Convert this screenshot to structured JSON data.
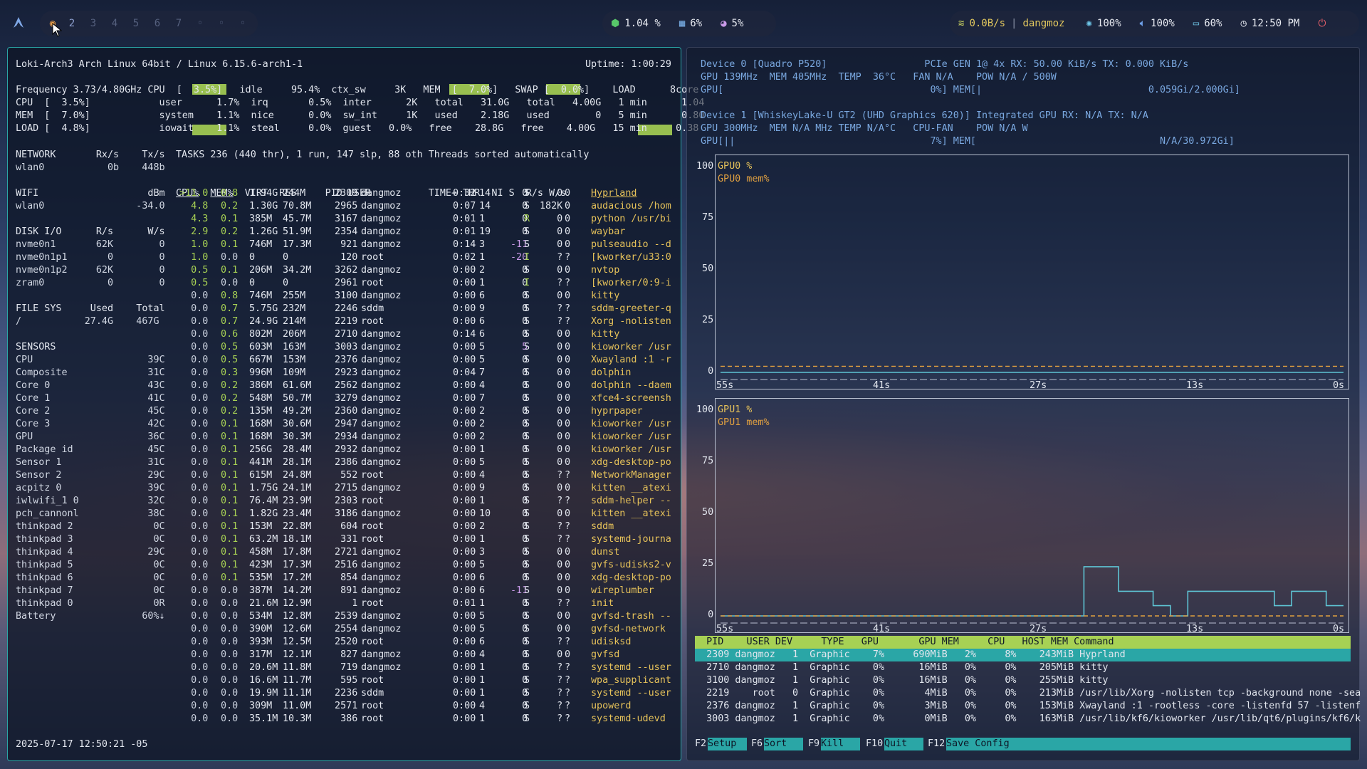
{
  "topbar": {
    "workspaces": [
      "2",
      "3",
      "4",
      "5",
      "6",
      "7",
      "◦",
      "◦",
      "◦"
    ],
    "cpu": "1.04 %",
    "ram": "6%",
    "disk": "5%",
    "network": "0.0B/s",
    "network_name": "dangmoz",
    "brightness": "100%",
    "volume": "100%",
    "battery": "60%",
    "clock": "12:50 PM"
  },
  "btop": {
    "host_line": "Loki-Arch3 Arch Linux 64bit / Linux 6.15.6-arch1-1",
    "uptime": "Uptime: 1:00:29",
    "summary": [
      "Frequency 3.73/4.80GHz CPU  [  3.5%]   idle     95.4%  ctx_sw     3K   MEM  [  7.0%]   SWAP [  0.0%]    LOAD      8core",
      "CPU  [  3.5%]            user      1.7%  irq       0.5%  inter      2K   total   31.0G   total   4.00G   1 min      1.04",
      "MEM  [  7.0%]            system    1.1%  nice      0.0%  sw_int     1K   used    2.18G   used        0   5 min      0.80",
      "LOAD [  4.8%]            iowait    1.1%  steal     0.0%  guest   0.0%   free    28.8G   free    4.00G   15 min     0.38"
    ],
    "tasks_line": "TASKS 236 (440 thr), 1 run, 147 slp, 88 oth Threads sorted automatically",
    "proc_header": "CPU%  MEM%  VIRT  RES     PID USER          TIME+ THR  NI S  R/s W/s  Command",
    "left_column": [
      "NETWORK       Rx/s    Tx/s",
      "wlan0           0b    448b",
      "",
      "WIFI                   dBm",
      "wlan0                -34.0",
      "",
      "DISK I/O      R/s      W/s",
      "nvme0n1       62K        0",
      "nvme0n1p1       0        0",
      "nvme0n1p2     62K        0",
      "zram0           0        0",
      "",
      "FILE SYS     Used    Total",
      "/           27.4G    467G",
      "",
      "SENSORS",
      "CPU                    39C",
      "Composite              31C",
      "Core 0                 43C",
      "Core 1                 41C",
      "Core 2                 45C",
      "Core 3                 42C",
      "GPU                    36C",
      "Package id             45C",
      "Sensor 1               31C",
      "Sensor 2               29C",
      "acpitz 0               39C",
      "iwlwifi_1 0            32C",
      "pch_cannonl            38C",
      "thinkpad 2              0C",
      "thinkpad 3              0C",
      "thinkpad 4             29C",
      "thinkpad 5              0C",
      "thinkpad 6              0C",
      "thinkpad 7              0C",
      "thinkpad 0              0R",
      "Battery               60%↓"
    ],
    "processes": [
      [
        ">11.0",
        "0.8",
        "1.94G",
        "244M",
        "2309",
        "dangmoz",
        "0:32",
        "14",
        "0",
        "S",
        "0",
        "0",
        "Hyprland"
      ],
      [
        "4.8",
        "0.2",
        "1.30G",
        "70.8M",
        "2965",
        "dangmoz",
        "0:07",
        "14",
        "0",
        "S",
        "182K",
        "0",
        "audacious /hom"
      ],
      [
        "4.3",
        "0.1",
        "385M",
        "45.7M",
        "3167",
        "dangmoz",
        "0:01",
        "1",
        "0",
        "R",
        "0",
        "0",
        "python /usr/bi"
      ],
      [
        "2.9",
        "0.2",
        "1.26G",
        "51.9M",
        "2354",
        "dangmoz",
        "0:01",
        "19",
        "0",
        "S",
        "0",
        "0",
        "waybar"
      ],
      [
        "1.0",
        "0.1",
        "746M",
        "17.3M",
        "921",
        "dangmoz",
        "0:14",
        "3",
        "-11",
        "S",
        "0",
        "0",
        "pulseaudio --d"
      ],
      [
        "1.0",
        "0.0",
        "0",
        "0",
        "120",
        "root",
        "0:02",
        "1",
        "-20",
        "I",
        "?",
        "?",
        "[kworker/u33:0"
      ],
      [
        "0.5",
        "0.1",
        "206M",
        "34.2M",
        "3262",
        "dangmoz",
        "0:00",
        "2",
        "0",
        "S",
        "0",
        "0",
        "nvtop"
      ],
      [
        "0.5",
        "0.0",
        "0",
        "0",
        "2961",
        "root",
        "0:00",
        "1",
        "0",
        "I",
        "?",
        "?",
        "[kworker/0:9-i"
      ],
      [
        "0.0",
        "0.8",
        "746M",
        "255M",
        "3100",
        "dangmoz",
        "0:00",
        "6",
        "0",
        "S",
        "0",
        "0",
        "kitty"
      ],
      [
        "0.0",
        "0.7",
        "5.75G",
        "232M",
        "2246",
        "sddm",
        "0:00",
        "9",
        "0",
        "S",
        "?",
        "?",
        "sddm-greeter-q"
      ],
      [
        "0.0",
        "0.7",
        "24.9G",
        "214M",
        "2219",
        "root",
        "0:00",
        "6",
        "0",
        "S",
        "?",
        "?",
        "Xorg -nolisten"
      ],
      [
        "0.0",
        "0.6",
        "802M",
        "206M",
        "2710",
        "dangmoz",
        "0:14",
        "6",
        "0",
        "S",
        "0",
        "0",
        "kitty"
      ],
      [
        "0.0",
        "0.5",
        "603M",
        "163M",
        "3003",
        "dangmoz",
        "0:00",
        "5",
        "5",
        "S",
        "0",
        "0",
        "kioworker /usr"
      ],
      [
        "0.0",
        "0.5",
        "667M",
        "153M",
        "2376",
        "dangmoz",
        "0:00",
        "5",
        "0",
        "S",
        "0",
        "0",
        "Xwayland :1 -r"
      ],
      [
        "0.0",
        "0.3",
        "996M",
        "109M",
        "2923",
        "dangmoz",
        "0:04",
        "7",
        "0",
        "S",
        "0",
        "0",
        "dolphin"
      ],
      [
        "0.0",
        "0.2",
        "386M",
        "61.6M",
        "2562",
        "dangmoz",
        "0:00",
        "4",
        "0",
        "S",
        "0",
        "0",
        "dolphin --daem"
      ],
      [
        "0.0",
        "0.2",
        "548M",
        "50.7M",
        "3279",
        "dangmoz",
        "0:00",
        "7",
        "0",
        "S",
        "0",
        "0",
        "xfce4-screensh"
      ],
      [
        "0.0",
        "0.2",
        "135M",
        "49.2M",
        "2360",
        "dangmoz",
        "0:00",
        "2",
        "0",
        "S",
        "0",
        "0",
        "hyprpaper"
      ],
      [
        "0.0",
        "0.1",
        "168M",
        "30.6M",
        "2947",
        "dangmoz",
        "0:00",
        "2",
        "0",
        "S",
        "0",
        "0",
        "kioworker /usr"
      ],
      [
        "0.0",
        "0.1",
        "168M",
        "30.3M",
        "2934",
        "dangmoz",
        "0:00",
        "2",
        "0",
        "S",
        "0",
        "0",
        "kioworker /usr"
      ],
      [
        "0.0",
        "0.1",
        "256G",
        "28.4M",
        "2932",
        "dangmoz",
        "0:00",
        "1",
        "0",
        "S",
        "0",
        "0",
        "kioworker /usr"
      ],
      [
        "0.0",
        "0.1",
        "441M",
        "28.1M",
        "2386",
        "dangmoz",
        "0:00",
        "5",
        "0",
        "S",
        "0",
        "0",
        "xdg-desktop-po"
      ],
      [
        "0.0",
        "0.1",
        "615M",
        "24.8M",
        "552",
        "root",
        "0:00",
        "4",
        "0",
        "S",
        "?",
        "?",
        "NetworkManager"
      ],
      [
        "0.0",
        "0.1",
        "1.75G",
        "24.1M",
        "2715",
        "dangmoz",
        "0:00",
        "9",
        "0",
        "S",
        "0",
        "0",
        "kitten __atexi"
      ],
      [
        "0.0",
        "0.1",
        "76.4M",
        "23.9M",
        "2303",
        "root",
        "0:00",
        "1",
        "0",
        "S",
        "?",
        "?",
        "sddm-helper --"
      ],
      [
        "0.0",
        "0.1",
        "1.82G",
        "23.4M",
        "3186",
        "dangmoz",
        "0:00",
        "10",
        "0",
        "S",
        "0",
        "0",
        "kitten __atexi"
      ],
      [
        "0.0",
        "0.1",
        "153M",
        "22.8M",
        "604",
        "root",
        "0:00",
        "2",
        "0",
        "S",
        "?",
        "?",
        "sddm"
      ],
      [
        "0.0",
        "0.1",
        "63.2M",
        "18.1M",
        "331",
        "root",
        "0:00",
        "1",
        "0",
        "S",
        "?",
        "?",
        "systemd-journa"
      ],
      [
        "0.0",
        "0.1",
        "458M",
        "17.8M",
        "2721",
        "dangmoz",
        "0:00",
        "3",
        "0",
        "S",
        "0",
        "0",
        "dunst"
      ],
      [
        "0.0",
        "0.1",
        "423M",
        "17.3M",
        "2516",
        "dangmoz",
        "0:00",
        "5",
        "0",
        "S",
        "0",
        "0",
        "gvfs-udisks2-v"
      ],
      [
        "0.0",
        "0.1",
        "535M",
        "17.2M",
        "854",
        "dangmoz",
        "0:00",
        "6",
        "0",
        "S",
        "0",
        "0",
        "xdg-desktop-po"
      ],
      [
        "0.0",
        "0.0",
        "387M",
        "14.2M",
        "891",
        "dangmoz",
        "0:00",
        "6",
        "-11",
        "S",
        "0",
        "0",
        "wireplumber"
      ],
      [
        "0.0",
        "0.0",
        "21.6M",
        "12.9M",
        "1",
        "root",
        "0:01",
        "1",
        "0",
        "S",
        "?",
        "?",
        "init"
      ],
      [
        "0.0",
        "0.0",
        "534M",
        "12.8M",
        "2539",
        "dangmoz",
        "0:00",
        "5",
        "0",
        "S",
        "0",
        "0",
        "gvfsd-trash --"
      ],
      [
        "0.0",
        "0.0",
        "390M",
        "12.6M",
        "2554",
        "dangmoz",
        "0:00",
        "5",
        "0",
        "S",
        "0",
        "0",
        "gvfsd-network"
      ],
      [
        "0.0",
        "0.0",
        "393M",
        "12.5M",
        "2520",
        "root",
        "0:00",
        "6",
        "0",
        "S",
        "?",
        "?",
        "udisksd"
      ],
      [
        "0.0",
        "0.0",
        "317M",
        "12.1M",
        "827",
        "dangmoz",
        "0:00",
        "4",
        "0",
        "S",
        "0",
        "0",
        "gvfsd"
      ],
      [
        "0.0",
        "0.0",
        "20.6M",
        "11.8M",
        "719",
        "dangmoz",
        "0:00",
        "1",
        "0",
        "S",
        "?",
        "?",
        "systemd --user"
      ],
      [
        "0.0",
        "0.0",
        "16.6M",
        "11.7M",
        "595",
        "root",
        "0:00",
        "1",
        "0",
        "S",
        "?",
        "?",
        "wpa_supplicant"
      ],
      [
        "0.0",
        "0.0",
        "19.9M",
        "11.1M",
        "2236",
        "sddm",
        "0:00",
        "1",
        "0",
        "S",
        "?",
        "?",
        "systemd --user"
      ],
      [
        "0.0",
        "0.0",
        "309M",
        "11.0M",
        "2571",
        "root",
        "0:00",
        "4",
        "0",
        "S",
        "?",
        "?",
        "upowerd"
      ],
      [
        "0.0",
        "0.0",
        "35.1M",
        "10.3M",
        "386",
        "root",
        "0:00",
        "1",
        "0",
        "S",
        "?",
        "?",
        "systemd-udevd"
      ]
    ],
    "datetime": "2025-07-17 12:50:21 -05"
  },
  "nvtop": {
    "device_lines": [
      "Device 0 [Quadro P520]                 PCIe GEN 1@ 4x RX: 50.00 KiB/s TX: 0.000 KiB/s",
      "GPU 139MHz  MEM 405MHz  TEMP  36°C   FAN N/A    POW N/A / 500W",
      "GPU[                                    0%] MEM[|                             0.059Gi/2.000Gi]",
      "",
      "Device 1 [WhiskeyLake-U GT2 (UHD Graphics 620)] Integrated GPU RX: N/A TX: N/A",
      "GPU 300MHz  MEM N/A MHz TEMP N/A°C   CPU-FAN    POW N/A W",
      "GPU[||                                  7%] MEM[                                N/A/30.972Gi]"
    ],
    "chart0_legend": [
      "GPU0 %",
      "GPU0 mem%"
    ],
    "chart1_legend": [
      "GPU1 %",
      "GPU1 mem%"
    ],
    "y_ticks": [
      "100",
      "75",
      "50",
      "25",
      "0"
    ],
    "x_ticks": [
      "55s",
      "41s",
      "27s",
      "13s",
      "0s"
    ],
    "table_header": "  PID    USER DEV     TYPE   GPU       GPU MEM     CPU   HOST MEM Command",
    "table_rows": [
      "  2309 dangmoz   1  Graphic    7%     690MiB   2%     8%    243MiB Hyprland",
      "  2710 dangmoz   1  Graphic    0%      16MiB   0%     0%    205MiB kitty",
      "  3100 dangmoz   1  Graphic    0%      16MiB   0%     0%    255MiB kitty",
      "  2219    root   0  Graphic    0%       4MiB   0%     0%    213MiB /usr/lib/Xorg -nolisten tcp -background none -sea",
      "  2376 dangmoz   1  Graphic    0%       3MiB   0%     0%    153MiB Xwayland :1 -rootless -core -listenfd 57 -listenf",
      "  3003 dangmoz   1  Graphic    0%       0MiB   0%     0%    163MiB /usr/lib/kf6/kioworker /usr/lib/qt6/plugins/kf6/k"
    ],
    "fkeys": [
      {
        "key": "F2",
        "label": "Setup"
      },
      {
        "key": "F6",
        "label": "Sort"
      },
      {
        "key": "F9",
        "label": "Kill"
      },
      {
        "key": "F10",
        "label": "Quit"
      },
      {
        "key": "F12",
        "label": "Save Config"
      }
    ]
  },
  "chart_data": [
    {
      "type": "line",
      "title": "",
      "series": [
        {
          "name": "GPU0 %",
          "values": [
            0,
            0,
            0,
            0,
            0,
            0,
            0,
            0,
            0,
            0,
            0,
            0
          ]
        },
        {
          "name": "GPU0 mem%",
          "values": [
            3,
            3,
            3,
            3,
            3,
            3,
            3,
            3,
            3,
            3,
            3,
            3
          ]
        }
      ],
      "x": [
        "55s",
        "41s",
        "27s",
        "13s",
        "0s"
      ],
      "ylim": [
        0,
        100
      ]
    },
    {
      "type": "line",
      "title": "",
      "series": [
        {
          "name": "GPU1 %",
          "values": [
            0,
            0,
            0,
            0,
            0,
            0,
            0,
            0,
            0,
            0,
            0,
            0,
            0,
            0,
            0,
            0,
            0,
            0,
            0,
            0,
            0,
            24,
            24,
            12,
            12,
            5,
            0,
            12,
            12,
            12,
            12,
            12,
            5,
            12,
            12,
            5
          ]
        },
        {
          "name": "GPU1 mem%",
          "values": [
            0,
            0,
            0,
            0,
            0,
            0,
            0,
            0,
            0,
            0,
            0,
            0,
            0,
            0,
            0,
            0,
            0,
            0,
            0,
            0,
            0,
            0,
            0,
            0,
            0,
            0,
            0,
            0,
            0,
            0,
            0,
            0,
            0,
            0,
            0,
            0
          ]
        }
      ],
      "x": [
        "55s",
        "41s",
        "27s",
        "13s",
        "0s"
      ],
      "ylim": [
        0,
        100
      ]
    }
  ],
  "colors": {
    "accent": "#2aa6a6",
    "green": "#a7d154",
    "yellow": "#e6c25a",
    "orange": "#e0a040"
  }
}
